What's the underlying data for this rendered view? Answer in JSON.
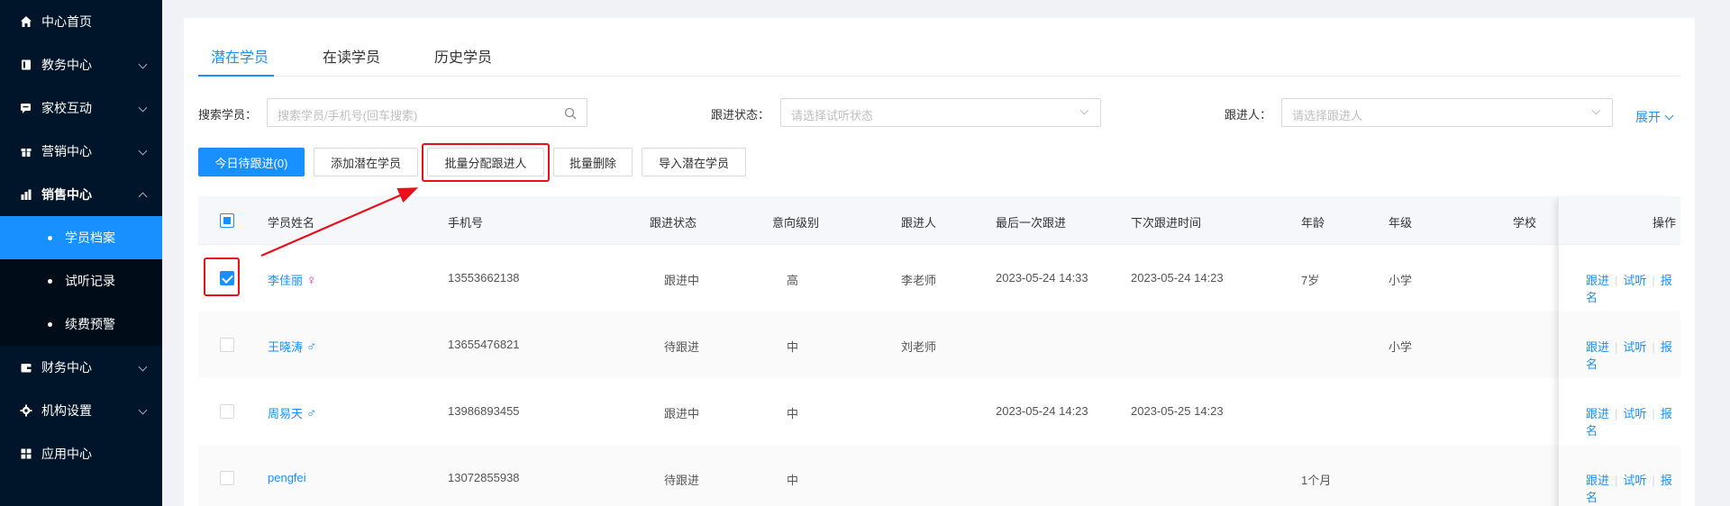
{
  "sidebar": {
    "items": [
      {
        "label": "中心首页",
        "icon": "home-icon",
        "has_caret": false
      },
      {
        "label": "教务中心",
        "icon": "book-icon",
        "has_caret": true
      },
      {
        "label": "家校互动",
        "icon": "chat-icon",
        "has_caret": true
      },
      {
        "label": "营销中心",
        "icon": "gift-icon",
        "has_caret": true
      },
      {
        "label": "销售中心",
        "icon": "chart-icon",
        "has_caret": true,
        "open": true
      }
    ],
    "sales_sub": [
      {
        "label": "学员档案",
        "active": true
      },
      {
        "label": "试听记录",
        "active": false
      },
      {
        "label": "续费预警",
        "active": false
      }
    ],
    "items_after": [
      {
        "label": "财务中心",
        "icon": "wallet-icon",
        "has_caret": true
      },
      {
        "label": "机构设置",
        "icon": "gear-icon",
        "has_caret": true
      },
      {
        "label": "应用中心",
        "icon": "grid-icon",
        "has_caret": false
      }
    ]
  },
  "tabs": [
    "潜在学员",
    "在读学员",
    "历史学员"
  ],
  "filters": {
    "search_label": "搜索学员：",
    "search_placeholder": "搜索学员/手机号(回车搜索)",
    "status_label": "跟进状态：",
    "status_placeholder": "请选择试听状态",
    "follower_label": "跟进人：",
    "follower_placeholder": "请选择跟进人",
    "expand_label": "展开"
  },
  "toolbar": {
    "today": "今日待跟进(0)",
    "add": "添加潜在学员",
    "assign": "批量分配跟进人",
    "delete": "批量删除",
    "import": "导入潜在学员"
  },
  "table": {
    "headers": {
      "name": "学员姓名",
      "phone": "手机号",
      "status": "跟进状态",
      "level": "意向级别",
      "follower": "跟进人",
      "last": "最后一次跟进",
      "next": "下次跟进时间",
      "age": "年龄",
      "grade": "年级",
      "school": "学校",
      "ops": "操作"
    },
    "rows": [
      {
        "name": "李佳丽",
        "gender": "♀",
        "gender_cls": "f",
        "phone": "13553662138",
        "status": "跟进中",
        "level": "高",
        "follower": "李老师",
        "last": "2023-05-24 14:33",
        "next": "2023-05-24 14:23",
        "age": "7岁",
        "grade": "小学",
        "checked": true
      },
      {
        "name": "王晓涛",
        "gender": "♂",
        "gender_cls": "m",
        "phone": "13655476821",
        "status": "待跟进",
        "level": "中",
        "follower": "刘老师",
        "last": "",
        "next": "",
        "age": "",
        "grade": "小学",
        "checked": false
      },
      {
        "name": "周易天",
        "gender": "♂",
        "gender_cls": "m",
        "phone": "13986893455",
        "status": "跟进中",
        "level": "中",
        "follower": "",
        "last": "2023-05-24 14:23",
        "next": "2023-05-25 14:23",
        "age": "",
        "grade": "",
        "checked": false
      },
      {
        "name": "pengfei",
        "gender": "",
        "gender_cls": "",
        "phone": "13072855938",
        "status": "待跟进",
        "level": "中",
        "follower": "",
        "last": "",
        "next": "",
        "age": "1个月",
        "grade": "",
        "checked": false
      }
    ],
    "ops": [
      "跟进",
      "试听",
      "报名"
    ]
  },
  "colors": {
    "accent": "#1890ff",
    "sidebar_bg": "#001529",
    "highlight": "#e8101b"
  }
}
